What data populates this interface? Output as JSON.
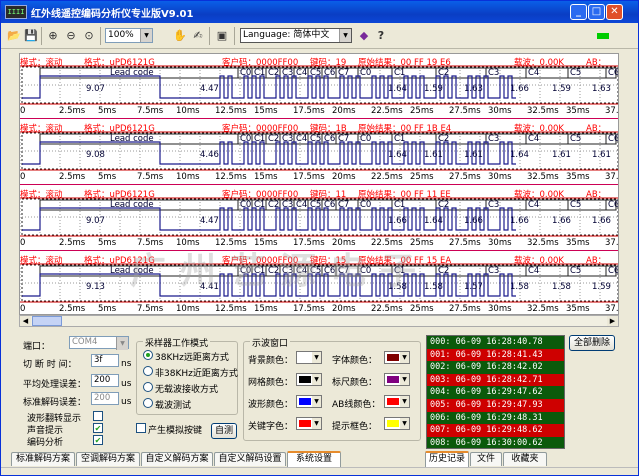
{
  "window": {
    "title": "红外线遥控编码分析仪专业版V9.01",
    "app_icon_text": "IIII"
  },
  "toolbar": {
    "zoom_value": "100%",
    "language_label": "Language:",
    "language_value": "简体中文",
    "help_glyph": "?"
  },
  "rows": [
    {
      "mode": "模式：滚动",
      "format": "格式：uPD6121G",
      "custom": "客户码：0000FF00",
      "key": "键码：19",
      "raw": "原始结果：00 FF 19 E6",
      "carrier": "载波：0.00K",
      "ab": "AB：",
      "lead": "Lead code",
      "cells": [
        "C0",
        "C1",
        "C2",
        "C3",
        "C4",
        "C5",
        "C6",
        "C7",
        "C0",
        "C1",
        "C2",
        "C3",
        "C4",
        "C5",
        "C6"
      ],
      "values": [
        "9.07",
        "4.47",
        "1.64",
        "1.59",
        "1.63",
        "1.66",
        "1.59",
        "1.63"
      ]
    },
    {
      "mode": "模式：滚动",
      "format": "格式：uPD6121G",
      "custom": "客户码：0000FF00",
      "key": "键码：1B",
      "raw": "原始结果：00 FF 1B E4",
      "carrier": "载波：0.00K",
      "ab": "AB：",
      "lead": "Lead code",
      "cells": [
        "C0",
        "C1",
        "C2",
        "C3",
        "C4",
        "C5",
        "C6",
        "C7",
        "C0",
        "C1",
        "C2",
        "C3",
        "C4",
        "C5",
        "C6"
      ],
      "values": [
        "9.08",
        "4.46",
        "1.64",
        "1.61",
        "1.61",
        "1.64",
        "1.61",
        "1.61"
      ]
    },
    {
      "mode": "模式：滚动",
      "format": "格式：uPD6121G",
      "custom": "客户码：0000FF00",
      "key": "键码：11",
      "raw": "原始结果：00 FF 11 EE",
      "carrier": "载波：0.00K",
      "ab": "AB：",
      "lead": "Lead code",
      "cells": [
        "C0",
        "C1",
        "C2",
        "C3",
        "C4",
        "C5",
        "C6",
        "C7",
        "C0",
        "C1",
        "C2",
        "C3",
        "C4",
        "C5",
        "C6"
      ],
      "values": [
        "9.07",
        "4.47",
        "1.66",
        "1.64",
        "1.66",
        "1.66",
        "1.66",
        "1.66"
      ]
    },
    {
      "mode": "模式：滚动",
      "format": "格式：uPD6121G",
      "custom": "客户码：0000FF00",
      "key": "键码：15",
      "raw": "原始结果：00 FF 15 EA",
      "carrier": "载波：0.00K",
      "ab": "AB：",
      "lead": "Lead code",
      "cells": [
        "C0",
        "C1",
        "C2",
        "C3",
        "C4",
        "C5",
        "C6",
        "C7",
        "C0",
        "C1",
        "C2",
        "C3",
        "C4",
        "C5",
        "C6"
      ],
      "values": [
        "9.13",
        "4.41",
        "1.58",
        "1.58",
        "1.57",
        "1.58",
        "1.58",
        "1.59"
      ]
    }
  ],
  "ruler_labels": [
    "0",
    "2.5ms",
    "5ms",
    "7.5ms",
    "10ms",
    "12.5ms",
    "15ms",
    "17.5ms",
    "20ms",
    "22.5ms",
    "25ms",
    "27.5ms",
    "30ms",
    "32.5ms",
    "35ms",
    "37."
  ],
  "watermark": "广州艺源电子",
  "settings": {
    "port_label": "端口：",
    "port_value": "COM4",
    "cut_label": "切 断  时 间：",
    "cut_value": "3f",
    "cut_unit": "ns",
    "avg_label": "平均处理误差：",
    "avg_value": "200",
    "avg_unit": "us",
    "std_label": "标准解码误差：",
    "std_value": "200",
    "std_unit": "us",
    "flip_label": "波形翻转显示",
    "sound_label": "声音提示",
    "analyze_label": "编码分析",
    "flip_checked": "",
    "sound_checked": "✔",
    "analyze_checked": "✔"
  },
  "sampler": {
    "title": "采样器工作模式",
    "options": [
      "38KHz远距离方式",
      "非38KHz近距离方式",
      "无载波接收方式",
      "载波测试"
    ],
    "simulate_label": "产生模拟按键",
    "self_test": "自测"
  },
  "scope": {
    "title": "示波窗口",
    "bg_label": "背景颜色：",
    "font_label": "字体颜色：",
    "grid_label": "网格颜色：",
    "ruler_label": "标尺颜色：",
    "wave_label": "波形颜色：",
    "ab_label": "AB线颜色：",
    "key_label": "关键字色：",
    "tip_label": "提示框色：",
    "colors": {
      "bg": "#ffffff",
      "font": "#800000",
      "grid": "#000000",
      "ruler": "#800080",
      "wave": "#0000ff",
      "ab": "#ff0000",
      "key": "#ff0000",
      "tip": "#ffff00"
    }
  },
  "history": [
    "000: 06-09 16:28:40.78",
    "001: 06-09 16:28:41.43",
    "002: 06-09 16:28:42.02",
    "003: 06-09 16:28:42.71",
    "004: 06-09 16:29:47.62",
    "005: 06-09 16:29:47.93",
    "006: 06-09 16:29:48.31",
    "007: 06-09 16:29:48.62",
    "008: 06-09 16:30:00.62"
  ],
  "clear_all": "全部删除",
  "tabs_left": [
    "标准解码方案",
    "空调解码方案",
    "自定义解码方案",
    "自定义解码设置",
    "系统设置"
  ],
  "tabs_right": [
    "历史记录",
    "文件",
    "收藏夹"
  ]
}
